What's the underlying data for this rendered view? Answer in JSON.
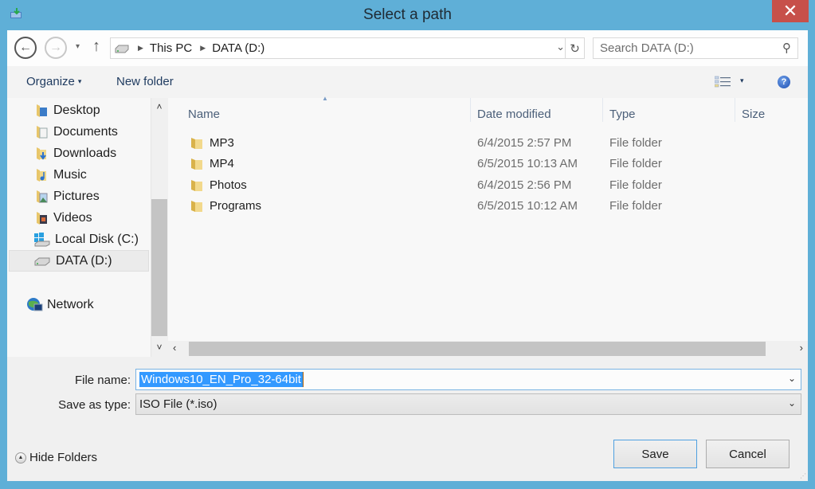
{
  "window": {
    "title": "Select a path",
    "close_label": "✕"
  },
  "navigation": {
    "back_label": "←",
    "forward_label": "→",
    "recent_label": "▾",
    "up_label": "↑",
    "breadcrumbs": [
      "This PC",
      "DATA (D:)"
    ],
    "address_dropdown": "⌄",
    "refresh_label": "↻",
    "search_placeholder": "Search DATA (D:)",
    "search_icon": "⚲"
  },
  "toolbar": {
    "organize_label": "Organize",
    "new_folder_label": "New folder",
    "caret": "▾",
    "help_label": "?"
  },
  "sidebar": {
    "items": [
      {
        "label": "Desktop",
        "icon": "desktop-folder-icon"
      },
      {
        "label": "Documents",
        "icon": "documents-folder-icon"
      },
      {
        "label": "Downloads",
        "icon": "downloads-folder-icon"
      },
      {
        "label": "Music",
        "icon": "music-folder-icon"
      },
      {
        "label": "Pictures",
        "icon": "pictures-folder-icon"
      },
      {
        "label": "Videos",
        "icon": "videos-folder-icon"
      },
      {
        "label": "Local Disk (C:)",
        "icon": "windows-drive-icon"
      },
      {
        "label": "DATA (D:)",
        "icon": "drive-icon",
        "selected": true
      }
    ],
    "network_label": "Network",
    "scroll_up": "˄",
    "scroll_down": "˅"
  },
  "file_list": {
    "columns": [
      "Name",
      "Date modified",
      "Type",
      "Size"
    ],
    "sort_indicator": "▲",
    "rows": [
      {
        "name": "MP3",
        "date": "6/4/2015 2:57 PM",
        "type": "File folder",
        "size": ""
      },
      {
        "name": "MP4",
        "date": "6/5/2015 10:13 AM",
        "type": "File folder",
        "size": ""
      },
      {
        "name": "Photos",
        "date": "6/4/2015 2:56 PM",
        "type": "File folder",
        "size": ""
      },
      {
        "name": "Programs",
        "date": "6/5/2015 10:12 AM",
        "type": "File folder",
        "size": ""
      }
    ],
    "scroll_left": "‹",
    "scroll_right": "›"
  },
  "form": {
    "file_name_label": "File name:",
    "file_name_value": "Windows10_EN_Pro_32-64bit",
    "save_as_type_label": "Save as type:",
    "save_as_type_value": "ISO File (*.iso)",
    "dropdown_caret": "⌄"
  },
  "footer": {
    "hide_folders_label": "Hide Folders",
    "hide_folders_icon": "▲",
    "save_label": "Save",
    "cancel_label": "Cancel"
  }
}
